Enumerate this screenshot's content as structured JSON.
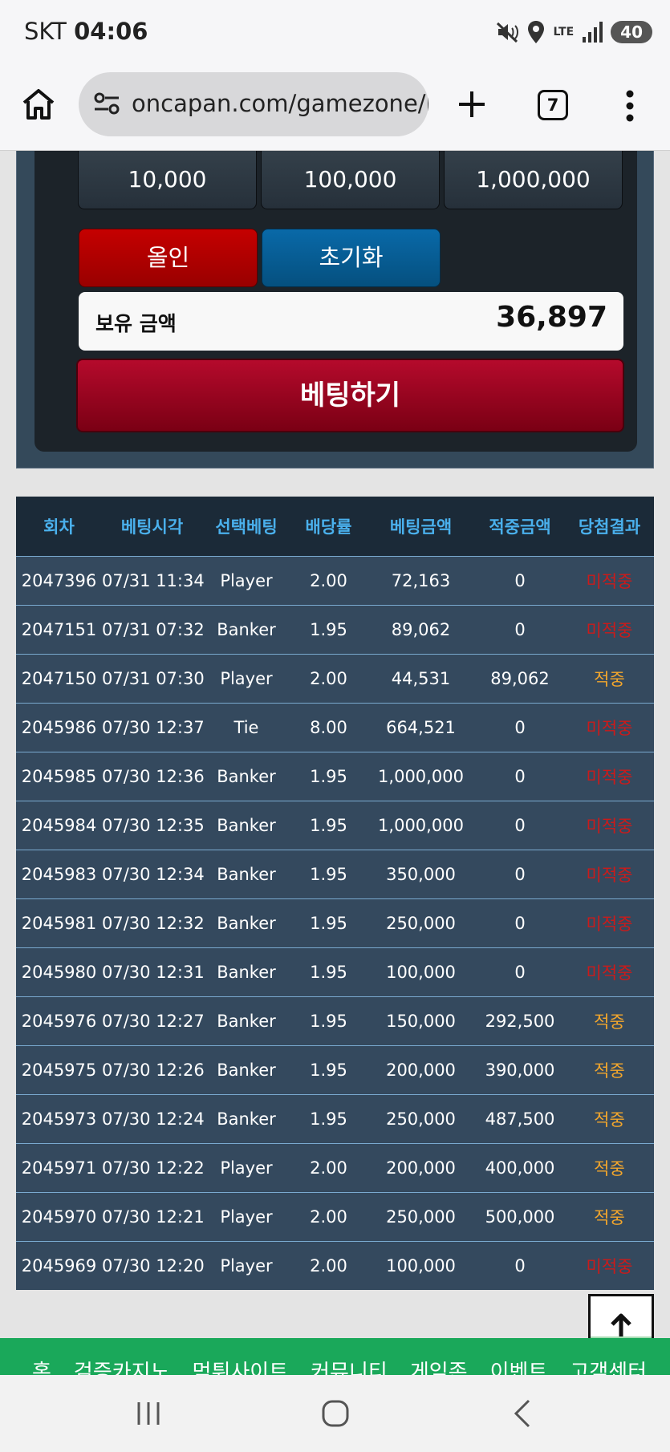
{
  "status_bar": {
    "carrier": "SKT",
    "time": "04:06",
    "network": "LTE",
    "battery": "40"
  },
  "browser": {
    "url": "oncapan.com/gamezone/ba",
    "tab_count": "7"
  },
  "bet_panel": {
    "chips": [
      "10,000",
      "100,000",
      "1,000,000"
    ],
    "allin_label": "올인",
    "reset_label": "초기화",
    "balance_label": "보유 금액",
    "balance_value": "36,897",
    "bet_button_label": "베팅하기"
  },
  "history": {
    "headers": [
      "회차",
      "베팅시각",
      "선택베팅",
      "배당률",
      "베팅금액",
      "적중금액",
      "당첨결과"
    ],
    "rows": [
      [
        "2047396",
        "07/31 11:34",
        "Player",
        "2.00",
        "72,163",
        "0",
        "미적중"
      ],
      [
        "2047151",
        "07/31 07:32",
        "Banker",
        "1.95",
        "89,062",
        "0",
        "미적중"
      ],
      [
        "2047150",
        "07/31 07:30",
        "Player",
        "2.00",
        "44,531",
        "89,062",
        "적중"
      ],
      [
        "2045986",
        "07/30 12:37",
        "Tie",
        "8.00",
        "664,521",
        "0",
        "미적중"
      ],
      [
        "2045985",
        "07/30 12:36",
        "Banker",
        "1.95",
        "1,000,000",
        "0",
        "미적중"
      ],
      [
        "2045984",
        "07/30 12:35",
        "Banker",
        "1.95",
        "1,000,000",
        "0",
        "미적중"
      ],
      [
        "2045983",
        "07/30 12:34",
        "Banker",
        "1.95",
        "350,000",
        "0",
        "미적중"
      ],
      [
        "2045981",
        "07/30 12:32",
        "Banker",
        "1.95",
        "250,000",
        "0",
        "미적중"
      ],
      [
        "2045980",
        "07/30 12:31",
        "Banker",
        "1.95",
        "100,000",
        "0",
        "미적중"
      ],
      [
        "2045976",
        "07/30 12:27",
        "Banker",
        "1.95",
        "150,000",
        "292,500",
        "적중"
      ],
      [
        "2045975",
        "07/30 12:26",
        "Banker",
        "1.95",
        "200,000",
        "390,000",
        "적중"
      ],
      [
        "2045973",
        "07/30 12:24",
        "Banker",
        "1.95",
        "250,000",
        "487,500",
        "적중"
      ],
      [
        "2045971",
        "07/30 12:22",
        "Player",
        "2.00",
        "200,000",
        "400,000",
        "적중"
      ],
      [
        "2045970",
        "07/30 12:21",
        "Player",
        "2.00",
        "250,000",
        "500,000",
        "적중"
      ],
      [
        "2045969",
        "07/30 12:20",
        "Player",
        "2.00",
        "100,000",
        "0",
        "미적중"
      ]
    ]
  },
  "result_colors": {
    "win": "#f3a62c",
    "lose": "#cc1a1a"
  },
  "footer_nav": [
    "홈",
    "검증카지노",
    "먹튀사이트",
    "커뮤니티",
    "게임존",
    "이벤트",
    "고객센터"
  ]
}
